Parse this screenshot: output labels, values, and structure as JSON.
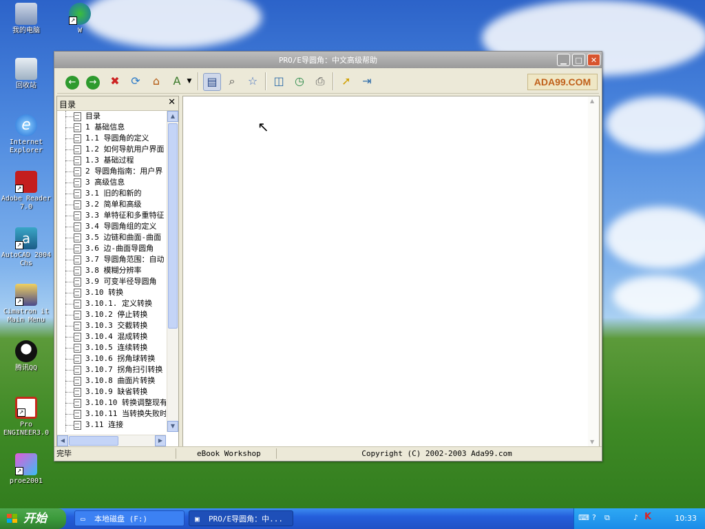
{
  "desktop": {
    "icons": [
      {
        "label": "我的电脑",
        "icon": "computer-icon"
      },
      {
        "label": "W",
        "icon": "network-icon"
      },
      {
        "label": "回收站",
        "icon": "recycle-bin-icon"
      },
      {
        "label": "Internet\nExplorer",
        "icon": "ie-icon"
      },
      {
        "label": "Adobe Reader\n7.0",
        "icon": "adobe-reader-icon"
      },
      {
        "label": "AutoCAD 2004\nChs",
        "icon": "autocad-icon"
      },
      {
        "label": "Cimatron it\nMain Menu",
        "icon": "cimatron-icon"
      },
      {
        "label": "腾讯QQ",
        "icon": "qq-icon"
      },
      {
        "label": "Pro\nENGINEER3.0",
        "icon": "proe-icon"
      },
      {
        "label": "proe2001",
        "icon": "proe2001-icon"
      }
    ]
  },
  "window": {
    "title": "PRO/E导圆角：中文高级帮助",
    "toolbar": {
      "buttons": [
        "back-icon",
        "forward-icon",
        "stop-icon",
        "refresh-icon",
        "home-icon",
        "font-icon",
        "dropdown-icon",
        "toc-icon",
        "search-icon",
        "favorites-icon",
        "window-icon",
        "history-icon",
        "print-icon",
        "pointer-icon",
        "export-icon"
      ],
      "logo": "ADA99.COM"
    },
    "toc": {
      "header": "目录",
      "items": [
        "目录",
        "1 基础信息",
        "1.1 导圆角的定义",
        "1.2 如何导航用户界面",
        "1.3 基础过程",
        "2 导圆角指南：用户界",
        "3 高级信息",
        "3.1 旧的和新的",
        "3.2 简单和高级",
        "3.3 单特征和多重特征",
        "3.4 导圆角组的定义",
        "3.5 边链和曲面-曲面",
        "3.6 边-曲面导圆角",
        "3.7 导圆角范围：自动",
        "3.8 模糊分辨率",
        "3.9 可变半径导圆角",
        "3.10 转换",
        "3.10.1. 定义转换",
        "3.10.2 停止转换",
        "3.10.3 交截转换",
        "3.10.4 混成转换",
        "3.10.5 连续转换",
        "3.10.6 拐角球转换",
        "3.10.7 拐角扫引转换",
        "3.10.8 曲面片转换",
        "3.10.9 缺省转换",
        "3.10.10 转换调整现有",
        "3.10.11 当转换失败时",
        "3.11 连接"
      ]
    },
    "status": {
      "left": "完毕",
      "middle": "eBook Workshop",
      "right": "Copyright (C) 2002-2003 Ada99.com"
    }
  },
  "taskbar": {
    "start_label": "开始",
    "tasks": [
      {
        "label": "本地磁盘 (F:)",
        "icon": "drive-icon"
      },
      {
        "label": "PRO/E导圆角：中...",
        "icon": "help-icon"
      }
    ],
    "clock": "10:33"
  }
}
